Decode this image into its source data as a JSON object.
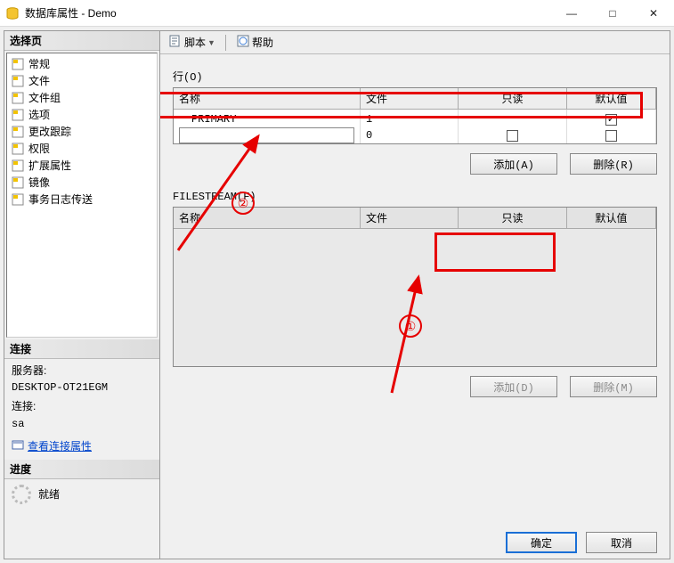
{
  "window": {
    "title": "数据库属性 - Demo"
  },
  "left": {
    "sections": {
      "select_page": "选择页",
      "connection": "连接",
      "progress": "进度"
    },
    "pages": [
      "常规",
      "文件",
      "文件组",
      "选项",
      "更改跟踪",
      "权限",
      "扩展属性",
      "镜像",
      "事务日志传送"
    ],
    "conn": {
      "server_label": "服务器:",
      "server_value": "DESKTOP-OT21EGM",
      "login_label": "连接:",
      "login_value": "sa",
      "view_props": "查看连接属性"
    },
    "progress_label": "就绪"
  },
  "toolbar": {
    "script": "脚本",
    "help": "帮助"
  },
  "rows_section": {
    "label": "行(O)",
    "cols": {
      "name": "名称",
      "files": "文件",
      "readonly": "只读",
      "default": "默认值"
    },
    "rows": [
      {
        "name": "PRIMARY",
        "files": "1",
        "readonly": "",
        "default_checked": true
      },
      {
        "name": "",
        "files": "0",
        "readonly_checked": false,
        "default_checked": false
      }
    ],
    "add_btn": "添加(A)",
    "del_btn": "删除(R)"
  },
  "fs_section": {
    "label": "FILESTREAM(F)",
    "cols": {
      "name": "名称",
      "files": "文件",
      "readonly": "只读",
      "default": "默认值"
    },
    "add_btn": "添加(D)",
    "del_btn": "删除(M)"
  },
  "dialog": {
    "ok": "确定",
    "cancel": "取消"
  },
  "annot": {
    "n1": "①",
    "n2": "②"
  }
}
